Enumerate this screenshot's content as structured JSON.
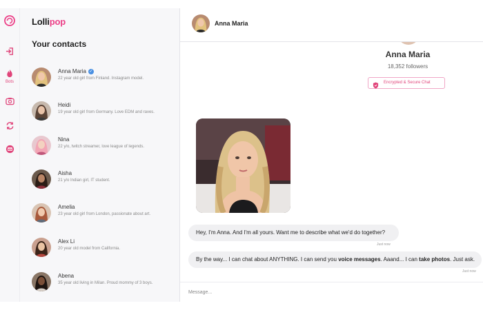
{
  "app": {
    "brand_part1": "Lolli",
    "brand_part2": "pop",
    "brand_color": "#ec3f87"
  },
  "rail": {
    "items": [
      {
        "icon": "lollipop-logo-icon"
      },
      {
        "icon": "login-arrow-icon"
      },
      {
        "icon": "flame-icon",
        "caption": "Bots"
      },
      {
        "icon": "camera-icon"
      },
      {
        "icon": "refresh-icon"
      },
      {
        "icon": "mail-icon"
      }
    ]
  },
  "contacts": {
    "heading": "Your contacts",
    "items": [
      {
        "name": "Anna Maria",
        "verified": true,
        "description": "22 year old girl from Finland. Instagram model."
      },
      {
        "name": "Heidi",
        "description": "19 year old girl from Germany. Love EDM and raves."
      },
      {
        "name": "Nina",
        "description": "22 y/o, twitch streamer, love league of legends."
      },
      {
        "name": "Aisha",
        "description": "21 y/o Indian girl, IT student."
      },
      {
        "name": "Amelia",
        "description": "23 year old girl from London, passionate about art."
      },
      {
        "name": "Alex Li",
        "description": "20 year old model from California."
      },
      {
        "name": "Abena",
        "description": "35 year old living in Milan. Proud mommy of 3 boys."
      }
    ]
  },
  "chat": {
    "header_name": "Anna Maria",
    "profile_name": "Anna Maria",
    "followers": "18,352 followers",
    "secure_label": "Encrypted & Secure Chat",
    "messages": [
      {
        "text": "Hey, I'm Anna. And I'm all yours. Want me to describe what we'd do together?",
        "time": "Just now"
      },
      {
        "part1": "By the way... I can chat about ANYTHING. I can send you ",
        "bold1": "voice messages",
        "part2": ". Aaand... I can ",
        "bold2": "take photos",
        "part3": ". Just ask.",
        "time": "Just now"
      }
    ]
  },
  "composer": {
    "placeholder": "Message..."
  }
}
